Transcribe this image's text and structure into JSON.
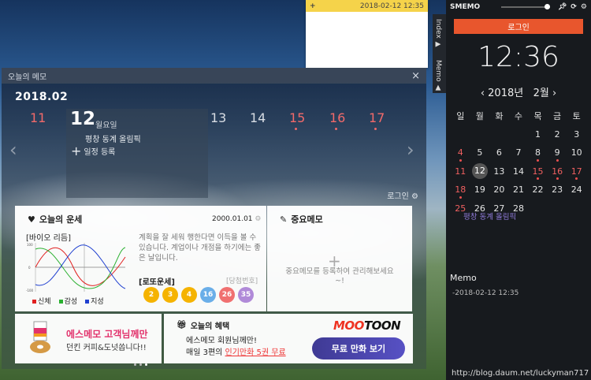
{
  "sticky": {
    "add": "+",
    "timestamp": "2018-02-12 12:35"
  },
  "panel": {
    "title": "오늘의 메모",
    "close": "×",
    "year_month": "2018.02",
    "days": [
      {
        "n": "11",
        "red": true,
        "dot": false
      },
      {
        "n": "13",
        "red": false,
        "dot": false
      },
      {
        "n": "14",
        "red": false,
        "dot": false
      },
      {
        "n": "15",
        "red": true,
        "dot": true
      },
      {
        "n": "16",
        "red": true,
        "dot": true
      },
      {
        "n": "17",
        "red": true,
        "dot": true
      }
    ],
    "today": {
      "num": "12",
      "weekday": "월요일",
      "event": "평창 동계 올림픽",
      "add_label": "일정 등록"
    },
    "login": "로그인"
  },
  "fortune": {
    "title": "오늘의 운세",
    "date": "2000.01.01",
    "biorhythm_label": "[바이오 리듬]",
    "text": "계획을 잘 세워 행한다면 이득을 볼 수 있습니다. 계업이나 개점을 하기에는 좋은 날입니다.",
    "legend": [
      {
        "label": "신체",
        "color": "#e02020"
      },
      {
        "label": "감성",
        "color": "#2ab030"
      },
      {
        "label": "지성",
        "color": "#2040d0"
      }
    ],
    "lotto_label": "[로또운세]",
    "lotto_sub": "[당첨번호]",
    "balls": [
      {
        "n": "2",
        "c": "#f5b300"
      },
      {
        "n": "3",
        "c": "#f5b300"
      },
      {
        "n": "4",
        "c": "#f5b300"
      },
      {
        "n": "16",
        "c": "#6aaee8"
      },
      {
        "n": "26",
        "c": "#f07070"
      },
      {
        "n": "35",
        "c": "#b08ad8"
      }
    ]
  },
  "memo": {
    "title": "중요메모",
    "plus": "+",
    "text": "중요메모를 등록하여 관리해보세요~!"
  },
  "ad1": {
    "title": "에스메모 고객님께만",
    "sub": "던킨 커피&도넛쏩니다!!"
  },
  "ad2": {
    "title": "오늘의 혜택",
    "line1": "에스메모 회원님께만!",
    "line2_a": "매일 3편의 ",
    "line2_b": "인기만화 5권 무료",
    "brand_a": "MOO",
    "brand_b": "TOON",
    "cta": "무료 만화 보기"
  },
  "sidebar": {
    "app": "SMEMO",
    "tab_index": "Index ▶",
    "tab_memo": "Memo ▲",
    "login": "로그인",
    "clock": "12:36",
    "year": "2018년",
    "month": "2월",
    "weekdays": [
      "일",
      "월",
      "화",
      "수",
      "목",
      "금",
      "토"
    ],
    "weeks": [
      [
        {
          "d": ""
        },
        {
          "d": ""
        },
        {
          "d": ""
        },
        {
          "d": ""
        },
        {
          "d": "1"
        },
        {
          "d": "2"
        },
        {
          "d": "3"
        }
      ],
      [
        {
          "d": "4",
          "s": 1,
          "m": 1
        },
        {
          "d": "5"
        },
        {
          "d": "6"
        },
        {
          "d": "7"
        },
        {
          "d": "8",
          "m": 1
        },
        {
          "d": "9",
          "m": 1
        },
        {
          "d": "10"
        }
      ],
      [
        {
          "d": "11",
          "s": 1
        },
        {
          "d": "12",
          "t": 1
        },
        {
          "d": "13"
        },
        {
          "d": "14"
        },
        {
          "d": "15",
          "s": 1,
          "m": 1
        },
        {
          "d": "16",
          "s": 1,
          "m": 1
        },
        {
          "d": "17",
          "s": 1,
          "m": 1
        }
      ],
      [
        {
          "d": "18",
          "s": 1,
          "m": 1
        },
        {
          "d": "19"
        },
        {
          "d": "20"
        },
        {
          "d": "21"
        },
        {
          "d": "22"
        },
        {
          "d": "23"
        },
        {
          "d": "24"
        }
      ],
      [
        {
          "d": "25",
          "s": 1
        },
        {
          "d": "26"
        },
        {
          "d": "27"
        },
        {
          "d": "28"
        },
        {
          "d": ""
        },
        {
          "d": ""
        },
        {
          "d": ""
        }
      ]
    ],
    "event": "평창 동계 올림픽",
    "memo_heading": "Memo",
    "memo_item": "-2018-02-12 12:35"
  },
  "watermark": "http://blog.daum.net/luckyman717"
}
